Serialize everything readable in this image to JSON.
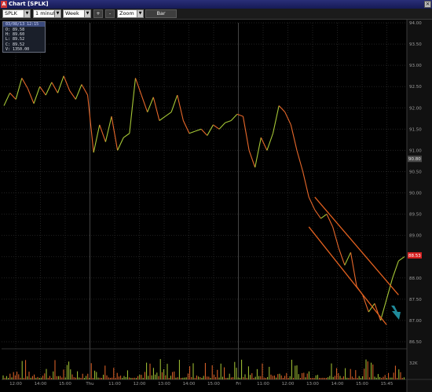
{
  "window": {
    "title": "Chart [SPLK]"
  },
  "toolbar": {
    "symbol": "SPLK",
    "interval": "1 minute",
    "range": "Week",
    "zoom_in": "+",
    "zoom_out": "-",
    "mode": "Zoom",
    "chart_type": "Bar"
  },
  "ohlc": {
    "header": "03/08/13 12:15",
    "open": "O: 89.58",
    "high": "H: 89.60",
    "low": "L: 89.52",
    "close": "C: 89.52",
    "volume": "V: 1350.00"
  },
  "colors": {
    "up": "#a7c836",
    "down": "#e8682a",
    "channel": "#e3611f",
    "arrow": "#1f8a9a",
    "last_price_bg": "#d62020",
    "grid": "#222222"
  },
  "chart_data": {
    "type": "line",
    "symbol": "SPLK",
    "y_ticks": [
      "94.00",
      "93.50",
      "93.00",
      "92.50",
      "92.00",
      "91.50",
      "91.00",
      "90.50",
      "90.00",
      "89.50",
      "89.00",
      "88.50",
      "88.00",
      "87.50",
      "87.00",
      "86.50"
    ],
    "ylim": [
      86.5,
      94.0
    ],
    "x_ticks": [
      "12:00",
      "14:00",
      "15:00",
      "Thu",
      "11:00",
      "12:00",
      "13:00",
      "14:00",
      "15:00",
      "Fri",
      "11:00",
      "12:00",
      "13:00",
      "14:00",
      "15:00",
      "15:45"
    ],
    "last_price": "88.53",
    "marker_price": "90.80",
    "volume_axis_label": "32K",
    "price_series": [
      [
        0,
        92.05
      ],
      [
        1,
        92.35
      ],
      [
        2,
        92.2
      ],
      [
        3,
        92.7
      ],
      [
        4,
        92.45
      ],
      [
        5,
        92.1
      ],
      [
        6,
        92.5
      ],
      [
        7,
        92.3
      ],
      [
        8,
        92.6
      ],
      [
        9,
        92.35
      ],
      [
        10,
        92.75
      ],
      [
        11,
        92.4
      ],
      [
        12,
        92.2
      ],
      [
        13,
        92.55
      ],
      [
        14,
        92.3
      ],
      [
        15,
        90.95
      ],
      [
        16,
        91.6
      ],
      [
        17,
        91.2
      ],
      [
        18,
        91.8
      ],
      [
        19,
        91.0
      ],
      [
        20,
        91.3
      ],
      [
        21,
        91.4
      ],
      [
        22,
        92.7
      ],
      [
        23,
        92.3
      ],
      [
        24,
        91.9
      ],
      [
        25,
        92.25
      ],
      [
        26,
        91.7
      ],
      [
        27,
        91.8
      ],
      [
        28,
        91.9
      ],
      [
        29,
        92.3
      ],
      [
        30,
        91.7
      ],
      [
        31,
        91.4
      ],
      [
        32,
        91.45
      ],
      [
        33,
        91.5
      ],
      [
        34,
        91.35
      ],
      [
        35,
        91.6
      ],
      [
        36,
        91.5
      ],
      [
        37,
        91.65
      ],
      [
        38,
        91.7
      ],
      [
        39,
        91.85
      ],
      [
        40,
        91.8
      ],
      [
        41,
        91.0
      ],
      [
        42,
        90.6
      ],
      [
        43,
        91.3
      ],
      [
        44,
        91.0
      ],
      [
        45,
        91.4
      ],
      [
        46,
        92.05
      ],
      [
        47,
        91.9
      ],
      [
        48,
        91.6
      ],
      [
        49,
        91.0
      ],
      [
        50,
        90.5
      ],
      [
        51,
        89.9
      ],
      [
        52,
        89.6
      ],
      [
        53,
        89.4
      ],
      [
        54,
        89.5
      ],
      [
        55,
        89.2
      ],
      [
        56,
        88.7
      ],
      [
        57,
        88.3
      ],
      [
        58,
        88.6
      ],
      [
        59,
        87.8
      ],
      [
        60,
        87.6
      ],
      [
        61,
        87.2
      ],
      [
        62,
        87.4
      ],
      [
        63,
        87.0
      ],
      [
        64,
        87.5
      ],
      [
        65,
        88.0
      ],
      [
        66,
        88.4
      ],
      [
        67,
        88.5
      ]
    ]
  }
}
